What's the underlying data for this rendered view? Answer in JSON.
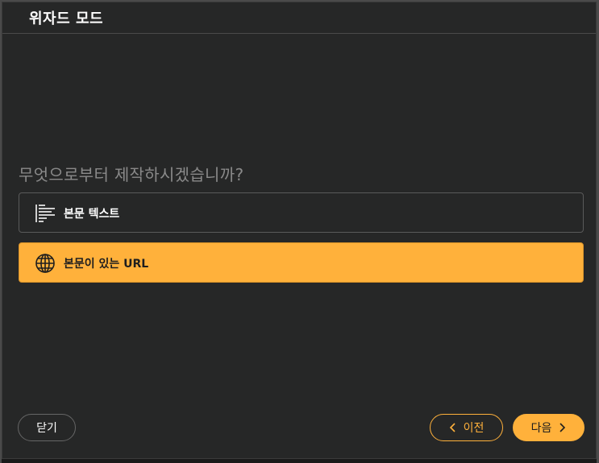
{
  "window": {
    "title": "위자드 모드"
  },
  "main": {
    "question": "무엇으로부터 제작하시겠습니까?",
    "options": [
      {
        "label": "본문 텍스트",
        "icon": "text-lines-icon",
        "selected": false
      },
      {
        "label": "본문이 있는 URL",
        "icon": "globe-icon",
        "selected": true
      }
    ]
  },
  "footer": {
    "close_label": "닫기",
    "prev_label": "이전",
    "next_label": "다음"
  },
  "colors": {
    "accent": "#ffb13b",
    "background": "#262727",
    "question_text": "#8a8a8a"
  }
}
